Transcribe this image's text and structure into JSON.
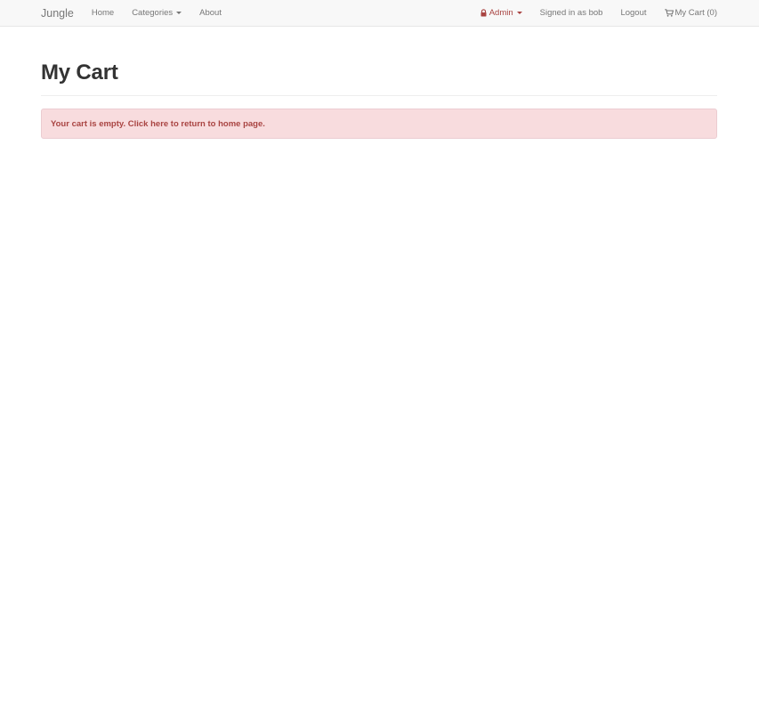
{
  "navbar": {
    "brand": "Jungle",
    "left_links": [
      {
        "label": "Home"
      },
      {
        "label": "Categories"
      },
      {
        "label": "About"
      }
    ],
    "right_links": {
      "admin": "Admin",
      "signed_in": "Signed in as bob",
      "logout": "Logout",
      "cart": "My Cart (0)"
    }
  },
  "page": {
    "title": "My Cart",
    "alert_message": "Your cart is empty. Click here to return to home page."
  },
  "colors": {
    "navbar_bg": "#f8f8f8",
    "alert_bg": "#f8dcde",
    "alert_text": "#a94442",
    "admin_link": "#a94442"
  },
  "icons": {
    "admin": "lock-icon",
    "cart": "shopping-cart-icon",
    "dropdown": "caret-down-icon"
  }
}
